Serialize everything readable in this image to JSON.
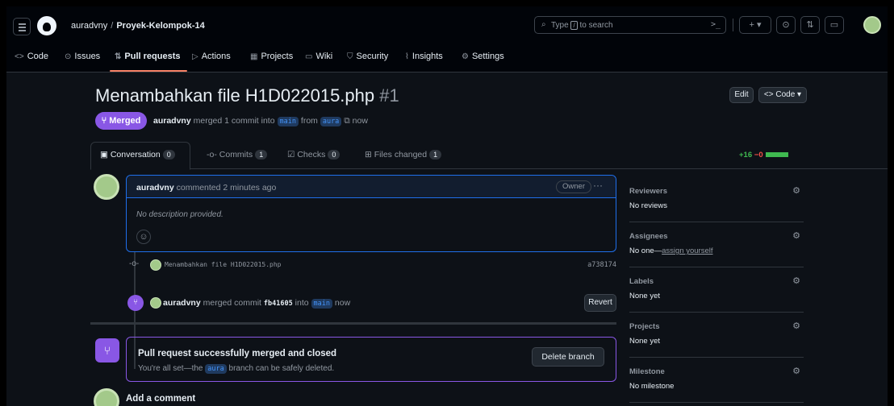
{
  "header": {
    "owner": "auradvny",
    "separator": "/",
    "repo": "Proyek-Kelompok-14",
    "search_prefix": "Type",
    "search_key": "/",
    "search_suffix": "to search",
    "terminal_icon": ">_",
    "plus_icon": "+",
    "caret": "▾"
  },
  "tabs": [
    {
      "label": "Code",
      "icon": "<>"
    },
    {
      "label": "Issues",
      "icon": "⊙"
    },
    {
      "label": "Pull requests",
      "icon": "⇅"
    },
    {
      "label": "Actions",
      "icon": "▷"
    },
    {
      "label": "Projects",
      "icon": "▦"
    },
    {
      "label": "Wiki",
      "icon": "▭"
    },
    {
      "label": "Security",
      "icon": "⛉"
    },
    {
      "label": "Insights",
      "icon": "⌇"
    },
    {
      "label": "Settings",
      "icon": "⚙"
    }
  ],
  "pr": {
    "title": "Menambahkan file H1D022015.php",
    "number": "#1",
    "edit_label": "Edit",
    "code_label": "<> Code ▾",
    "status": "Merged",
    "author": "auradvny",
    "merge_text_1": "merged 1 commit into",
    "base_branch": "main",
    "merge_text_2": "from",
    "head_branch": "aura",
    "merge_text_3": "now"
  },
  "pr_tabs": {
    "conversation": {
      "label": "Conversation",
      "count": "0"
    },
    "commits": {
      "label": "Commits",
      "count": "1"
    },
    "checks": {
      "label": "Checks",
      "count": "0"
    },
    "files": {
      "label": "Files changed",
      "count": "1"
    },
    "additions": "+16",
    "deletions": "−0"
  },
  "comment": {
    "author": "auradvny",
    "meta": "commented 2 minutes ago",
    "role": "Owner",
    "more": "···",
    "body": "No description provided."
  },
  "commit": {
    "message": "Menambahkan file H1D022015.php",
    "sha": "a738174"
  },
  "merge_event": {
    "author": "auradvny",
    "text_1": "merged commit",
    "commit": "fb41605",
    "text_2": "into",
    "branch": "main",
    "text_3": "now",
    "revert_label": "Revert"
  },
  "merge_box": {
    "title": "Pull request successfully merged and closed",
    "desc_1": "You're all set—the",
    "branch": "aura",
    "desc_2": "branch can be safely deleted.",
    "delete_label": "Delete branch"
  },
  "add_comment": "Add a comment",
  "sidebar": {
    "reviewers": {
      "title": "Reviewers",
      "value": "No reviews"
    },
    "assignees": {
      "title": "Assignees",
      "value": "No one—",
      "link": "assign yourself"
    },
    "labels": {
      "title": "Labels",
      "value": "None yet"
    },
    "projects": {
      "title": "Projects",
      "value": "None yet"
    },
    "milestone": {
      "title": "Milestone",
      "value": "No milestone"
    }
  },
  "colors": {
    "merged": "#8957e5",
    "accent": "#f78166",
    "link": "#4493f8",
    "additions": "#3fb950",
    "deletions": "#f85149"
  }
}
